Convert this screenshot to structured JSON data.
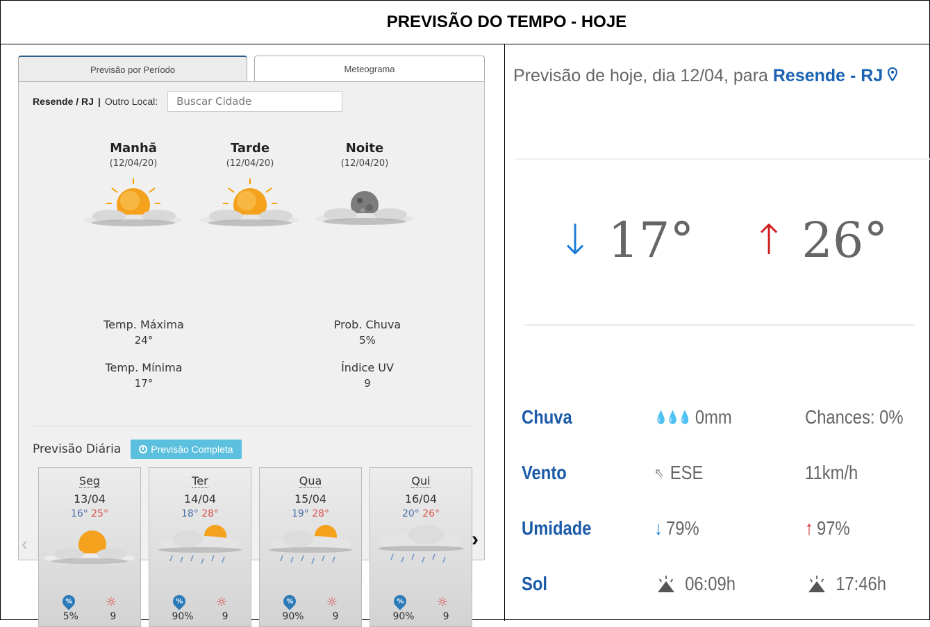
{
  "header": {
    "title": "PREVISÃO DO TEMPO - HOJE"
  },
  "left": {
    "tabs": [
      {
        "label": "Previsão por Período"
      },
      {
        "label": "Meteograma"
      }
    ],
    "location": {
      "city": "Resende / RJ",
      "separator": "|",
      "other_label": "Outro Local:",
      "search_placeholder": "Buscar Cidade"
    },
    "periods": [
      {
        "name": "Manhã",
        "date": "(12/04/20)",
        "icon": "partly-cloudy-sun-icon"
      },
      {
        "name": "Tarde",
        "date": "(12/04/20)",
        "icon": "partly-cloudy-sun-icon"
      },
      {
        "name": "Noite",
        "date": "(12/04/20)",
        "icon": "partly-cloudy-moon-icon"
      }
    ],
    "stats": {
      "max_label": "Temp. Máxima",
      "max_value": "24°",
      "min_label": "Temp. Mínima",
      "min_value": "17°",
      "rain_label": "Prob. Chuva",
      "rain_value": "5%",
      "uv_label": "Índice UV",
      "uv_value": "9"
    },
    "daily": {
      "label": "Previsão Diária",
      "button": "Previsão Completa",
      "days": [
        {
          "name": "Seg",
          "date": "13/04",
          "min": "16°",
          "max": "25°",
          "rain": "5%",
          "uv": "9",
          "icon": "partly-cloudy-sun-icon"
        },
        {
          "name": "Ter",
          "date": "14/04",
          "min": "18°",
          "max": "28°",
          "rain": "90%",
          "uv": "9",
          "icon": "rain-sun-icon"
        },
        {
          "name": "Qua",
          "date": "15/04",
          "min": "19°",
          "max": "28°",
          "rain": "90%",
          "uv": "9",
          "icon": "rain-sun-icon"
        },
        {
          "name": "Qui",
          "date": "16/04",
          "min": "20°",
          "max": "26°",
          "rain": "90%",
          "uv": "9",
          "icon": "rain-cloud-icon"
        }
      ]
    }
  },
  "right": {
    "title_prefix": "Previsão de hoje, dia 12/04, para",
    "city": "Resende - RJ",
    "temp_min": "17°",
    "temp_max": "26°",
    "rows": [
      {
        "label": "Chuva",
        "v1": "0mm",
        "v2": "Chances: 0%"
      },
      {
        "label": "Vento",
        "v1": "ESE",
        "v2": "11km/h"
      },
      {
        "label": "Umidade",
        "v1": "79%",
        "v2": "97%"
      },
      {
        "label": "Sol",
        "v1": "06:09h",
        "v2": "17:46h"
      }
    ],
    "colors": {
      "accent_blue": "#1a5aa8",
      "down_blue": "#1a7ad4",
      "up_red": "#d01c1c"
    }
  }
}
